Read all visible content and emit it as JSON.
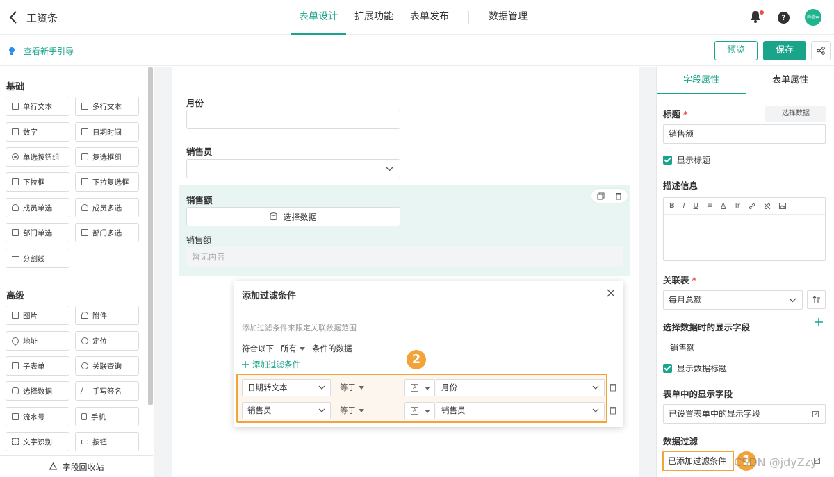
{
  "header": {
    "title": "工资条",
    "tabs": [
      {
        "label": "表单设计",
        "active": true
      },
      {
        "label": "扩展功能",
        "active": false
      },
      {
        "label": "表单发布",
        "active": false
      },
      {
        "label": "数据管理",
        "active": false
      }
    ],
    "help_glyph": "?",
    "avatar_text": "简道云"
  },
  "subbar": {
    "guide_label": "查看新手引导",
    "preview_label": "预览",
    "save_label": "保存"
  },
  "left_panel": {
    "basic_title": "基础",
    "basic_items": [
      "单行文本",
      "多行文本",
      "数字",
      "日期时间",
      "单选按钮组",
      "复选框组",
      "下拉框",
      "下拉复选框",
      "成员单选",
      "成员多选",
      "部门单选",
      "部门多选",
      "分割线"
    ],
    "advanced_title": "高级",
    "advanced_items": [
      "图片",
      "附件",
      "地址",
      "定位",
      "子表单",
      "关联查询",
      "选择数据",
      "手写签名",
      "流水号",
      "手机",
      "文字识别",
      "按钮"
    ],
    "recycle_label": "字段回收站"
  },
  "form": {
    "month_label": "月份",
    "salesperson_label": "销售员",
    "sales_label": "销售额",
    "select_data_label": "选择数据",
    "sub_label": "销售额",
    "empty_text": "暂无内容"
  },
  "dialog": {
    "title": "添加过滤条件",
    "description": "添加过滤条件来限定关联数据范围",
    "match_prefix": "符合以下",
    "match_mode": "所有",
    "match_suffix": "条件的数据",
    "add_label": "添加过滤条件",
    "conditions": [
      {
        "field": "日期转文本",
        "operator": "等于",
        "value": "月份"
      },
      {
        "field": "销售员",
        "operator": "等于",
        "value": "销售员"
      }
    ],
    "type_glyph": "A",
    "step_badge": "2"
  },
  "right_panel": {
    "tabs": [
      {
        "label": "字段属性",
        "active": true
      },
      {
        "label": "表单属性",
        "active": false
      }
    ],
    "title_label": "标题",
    "select_data_label": "选择数据",
    "title_value": "销售额",
    "show_title_label": "显示标题",
    "desc_label": "描述信息",
    "editor_tools": [
      "B",
      "I",
      "U",
      "≡",
      "A",
      "Tr"
    ],
    "link_table_label": "关联表",
    "link_table_value": "每月总额",
    "display_field_label": "选择数据时的显示字段",
    "display_field_value": "销售额",
    "show_data_title_label": "显示数据标题",
    "form_display_label": "表单中的显示字段",
    "form_display_value": "已设置表单中的显示字段",
    "data_filter_label": "数据过滤",
    "data_filter_value": "已添加过滤条件",
    "step_badge": "1",
    "required_mark": "*"
  },
  "watermark": "CSDN @jdyZzy",
  "colors": {
    "accent": "#1aa58a",
    "highlight": "#f2a33a",
    "selected_bg": "#e8f5f2"
  }
}
